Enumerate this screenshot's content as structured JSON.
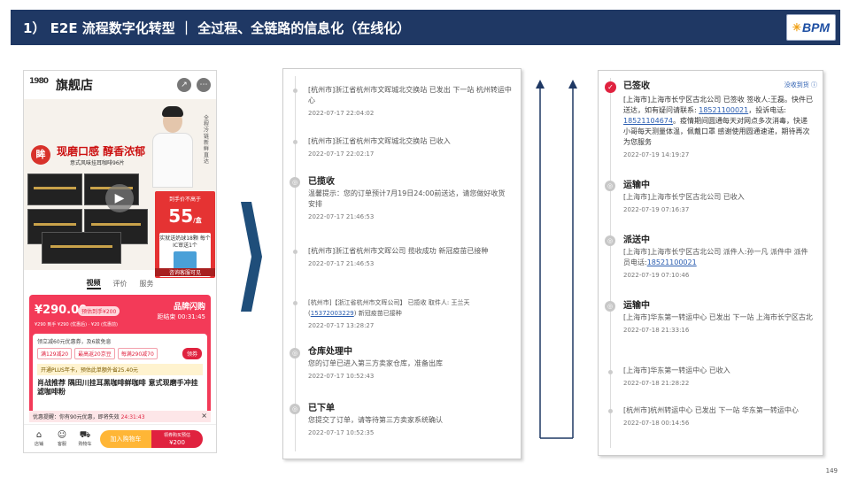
{
  "header": {
    "title": "1）  E2E 流程数字化转型  ｜  全过程、全链路的信息化（在线化）",
    "logo_text": "BPM"
  },
  "phone": {
    "shop_name": "旗舰店",
    "shop_logo": "1980",
    "promo": {
      "badge": "眸",
      "title": "现磨口感 醇香浓郁",
      "subtitle": "意式风味挂耳咖啡96片",
      "vertical_text": "全程冷链新鲜直达"
    },
    "price_card": {
      "top": "到手价不高于",
      "price": "55",
      "unit": "/盒",
      "inner_text": "实就送奶球18颗 每个IC审送1个",
      "footer": "咨询客服可见"
    },
    "tabs": [
      "视频",
      "评价",
      "服务"
    ],
    "sale": {
      "price": "¥290.00",
      "tag": "预估到手¥200",
      "flash": "品牌闪购",
      "countdown": "距结束 00:31:45",
      "line": "¥290 到手 ¥290 (优惠后) · ¥20 (优惠前)"
    },
    "coupons": {
      "line1": "领立减60元优惠券，及6款免息",
      "chips": [
        "满129减20",
        "最高返20京豆",
        "每满290减70"
      ],
      "collect": "领券",
      "plus": "开通PLUS年卡，预估此单额外省25.40元",
      "product_title": "肖战推荐 隅田川挂耳黑咖啡鲜咖啡 意式现磨手冲挂滤咖啡粉"
    },
    "coupon_bar": {
      "prefix": "优惠提醒：",
      "text": "你有90元优惠，即将失效",
      "time": "24:31:43"
    },
    "bottom": {
      "items": [
        "店铺",
        "客服",
        "购物车"
      ],
      "cart": "加入购物车",
      "buy_line1": "领券购买预估",
      "buy_line2": "¥200"
    }
  },
  "timeline_left": {
    "items": [
      {
        "title": "",
        "body": "[杭州市]浙江省杭州市文晖城北交换站 已发出 下一站 杭州转运中心",
        "time": "2022-07-17 22:04:02"
      },
      {
        "title": "",
        "body": "[杭州市]浙江省杭州市文晖城北交换站 已收入",
        "time": "2022-07-17 22:02:17"
      },
      {
        "title": "已揽收",
        "body": "温馨提示：您的订单预计7月19日24:00前送达，请您做好收货安排",
        "time": "2022-07-17 21:46:53"
      },
      {
        "title": "",
        "body": "[杭州市]浙江省杭州市文晖公司 揽收成功 新冠疫苗已接种",
        "time": "2022-07-17 21:46:53"
      },
      {
        "title": "",
        "body_prefix": "[杭州市]【浙江省杭州市文晖公司】 已揽收 取件人: 王兰天(",
        "phone": "15372003229",
        "body_suffix": ") 新冠疫苗已接种",
        "time": "2022-07-17 13:28:27"
      },
      {
        "title": "仓库处理中",
        "body": "您的订单已进入第三方卖家仓库，准备出库",
        "time": "2022-07-17 10:52:43"
      },
      {
        "title": "已下单",
        "body": "您提交了订单，请等待第三方卖家系统确认",
        "time": "2022-07-17 10:52:35"
      }
    ]
  },
  "timeline_right": {
    "corner": "没收到货 ⓘ",
    "signed": {
      "title": "已签收",
      "body_a": "[上海市]上海市长宁区古北公司 已签收  签收人:王磊。快件已送达，如有疑问请联系: ",
      "phone1": "18521100021",
      "body_b": "，投诉电话: ",
      "phone2": "18521104674",
      "body_c": "。疫情期间圆通每天对网点多次消毒，快递小哥每天测量体温，佩戴口罩 感谢使用圆通速递，期待再次为您服务",
      "time": "2022-07-19 14:19:27"
    },
    "items": [
      {
        "title": "运输中",
        "body": "[上海市]上海市长宁区古北公司 已收入",
        "time": "2022-07-19 07:16:37"
      },
      {
        "title": "派送中",
        "body_prefix": "[上海市]上海市长宁区古北公司 派件人:孙一凡 派件中 派件员电话:",
        "phone": "18521100021",
        "time": "2022-07-19 07:10:46"
      },
      {
        "title": "运输中",
        "body": "[上海市]华东第一转运中心 已发出 下一站 上海市长宁区古北",
        "time": "2022-07-18 21:33:16"
      },
      {
        "title": "",
        "body": "[上海市]华东第一转运中心 已收入",
        "time": "2022-07-18 21:28:22"
      },
      {
        "title": "",
        "body": "[杭州市]杭州转运中心 已发出 下一站 华东第一转运中心",
        "time": "2022-07-18 00:14:56"
      }
    ]
  },
  "page_number": "149"
}
